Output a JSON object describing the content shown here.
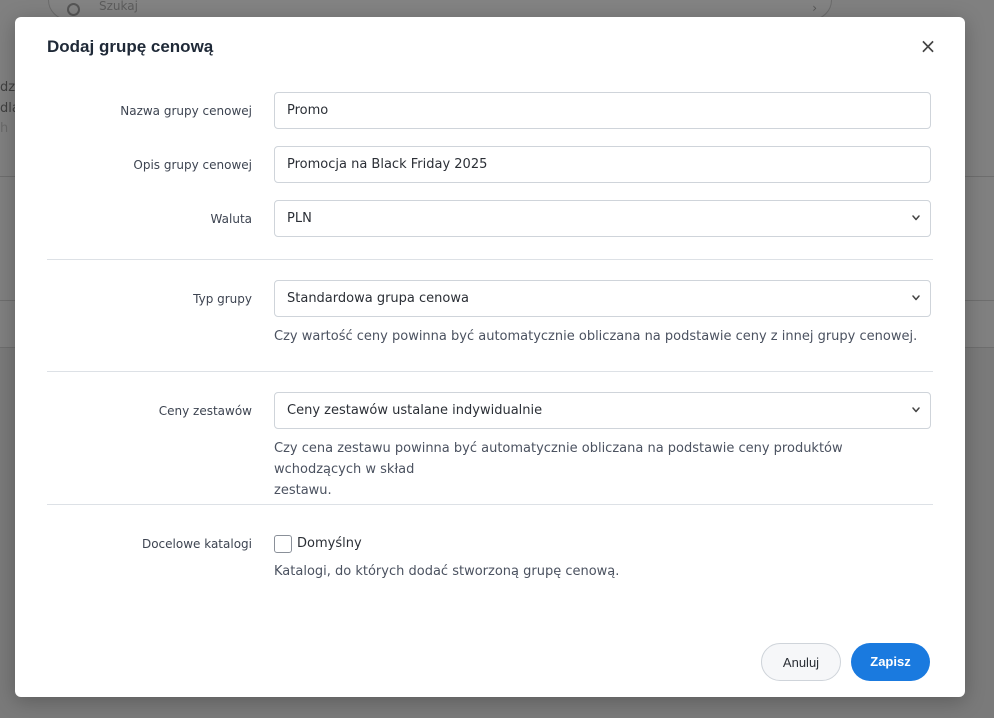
{
  "background": {
    "search_placeholder": "Szukaj",
    "fragments": [
      "dzi",
      "dla",
      "h"
    ]
  },
  "modal": {
    "title": "Dodaj grupę cenową",
    "close_icon": "close-icon"
  },
  "fields": {
    "name": {
      "label": "Nazwa grupy cenowej",
      "value": "Promo"
    },
    "description": {
      "label": "Opis grupy cenowej",
      "value": "Promocja na Black Friday 2025"
    },
    "currency": {
      "label": "Waluta",
      "selected": "PLN"
    },
    "group_type": {
      "label": "Typ grupy",
      "selected": "Standardowa grupa cenowa",
      "help": "Czy wartość ceny powinna być automatycznie obliczana na podstawie ceny z innej grupy cenowej."
    },
    "set_prices": {
      "label": "Ceny zestawów",
      "selected": "Ceny zestawów ustalane indywidualnie",
      "help_line1": "Czy cena zestawu powinna być automatycznie obliczana na podstawie ceny produktów wchodzących w skład",
      "help_line2": "zestawu."
    },
    "catalogs": {
      "label": "Docelowe katalogi",
      "checkbox_label": "Domyślny",
      "checked": false,
      "help": "Katalogi, do których dodać stworzoną grupę cenową."
    }
  },
  "footer": {
    "cancel_label": "Anuluj",
    "save_label": "Zapisz"
  },
  "colors": {
    "primary": "#1a7adf",
    "overlay": "#7a7a7a"
  }
}
